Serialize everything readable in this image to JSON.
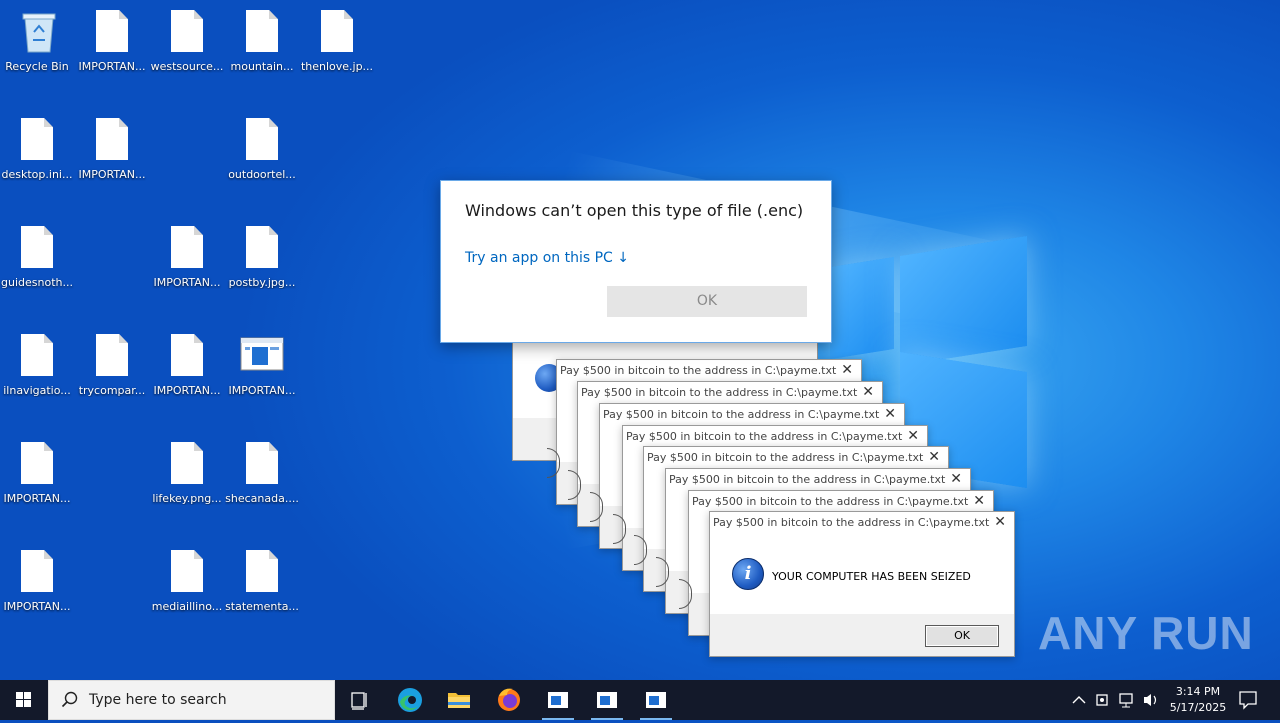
{
  "desktop_icons": [
    {
      "label": "Recycle Bin",
      "icon": "recycle-bin-icon"
    },
    {
      "label": "IMPORTAN...",
      "icon": "file-icon"
    },
    {
      "label": "westsource...",
      "icon": "file-icon"
    },
    {
      "label": "mountain...",
      "icon": "file-icon"
    },
    {
      "label": "thenlove.jp...",
      "icon": "file-icon"
    },
    {
      "label": "desktop.ini...",
      "icon": "file-icon"
    },
    {
      "label": "IMPORTAN...",
      "icon": "file-icon"
    },
    {
      "label": "outdoortel...",
      "icon": "file-icon"
    },
    {
      "label": "guidesnoth...",
      "icon": "file-icon"
    },
    {
      "label": "IMPORTAN...",
      "icon": "file-icon"
    },
    {
      "label": "postby.jpg...",
      "icon": "file-icon"
    },
    {
      "label": "ilnavigatio...",
      "icon": "file-icon"
    },
    {
      "label": "trycompar...",
      "icon": "file-icon"
    },
    {
      "label": "IMPORTAN...",
      "icon": "file-icon"
    },
    {
      "label": "IMPORTAN...",
      "icon": "app-window-icon"
    },
    {
      "label": "IMPORTAN...",
      "icon": "file-icon"
    },
    {
      "label": "lifekey.png...",
      "icon": "file-icon"
    },
    {
      "label": "shecanada....",
      "icon": "file-icon"
    },
    {
      "label": "IMPORTAN...",
      "icon": "file-icon"
    },
    {
      "label": "mediaillino...",
      "icon": "file-icon"
    },
    {
      "label": "statementa...",
      "icon": "file-icon"
    }
  ],
  "open_with_dialog": {
    "title": "Windows can’t open this type of file (.enc)",
    "link": "Try an app on this PC ↓",
    "ok": "OK"
  },
  "ransom_boxes": {
    "title": "Pay $500 in bitcoin to the address in C:\\payme.txt",
    "message": "YOUR COMPUTER HAS BEEN SEIZED",
    "ok": "OK",
    "close": "✕",
    "count": 8
  },
  "taskbar": {
    "search_placeholder": "Type here to search",
    "time": "3:14 PM",
    "date": "5/17/2025"
  },
  "watermark": "ANY RUN"
}
